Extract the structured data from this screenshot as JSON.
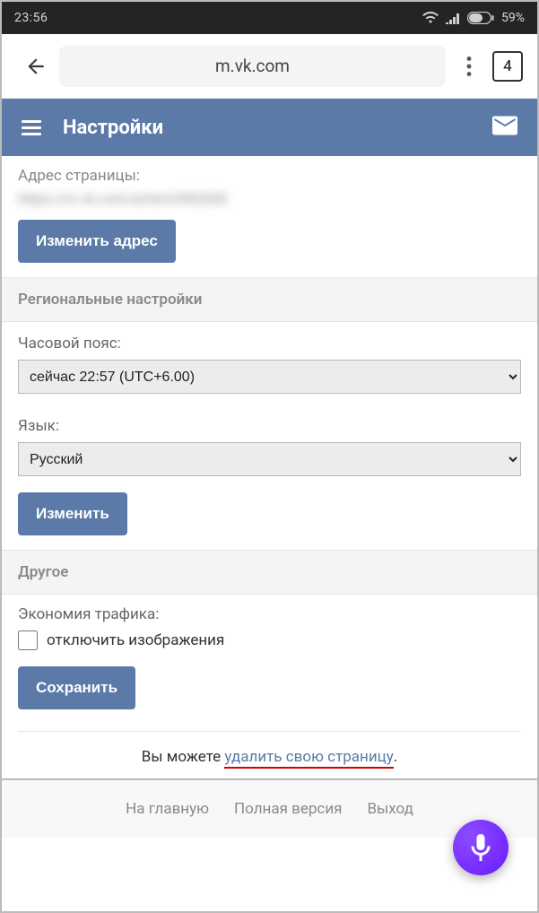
{
  "statusBar": {
    "time": "23:56",
    "battery": "59%"
  },
  "browser": {
    "url": "m.vk.com",
    "tabs": "4"
  },
  "header": {
    "title": "Настройки"
  },
  "addressSection": {
    "label": "Адрес страницы:",
    "blurred": "https://m.vk.com/artem2982000",
    "button": "Изменить адрес"
  },
  "regional": {
    "header": "Региональные настройки",
    "tz_label": "Часовой пояс:",
    "tz_value": "сейчас 22:57 (UTC+6.00)",
    "lang_label": "Язык:",
    "lang_value": "Русский",
    "button": "Изменить"
  },
  "other": {
    "header": "Другое",
    "traffic_label": "Экономия трафика:",
    "checkbox_label": "отключить изображения",
    "save_button": "Сохранить"
  },
  "deleteRow": {
    "prefix": "Вы можете ",
    "link": "удалить свою страницу",
    "suffix": "."
  },
  "footer": {
    "home": "На главную",
    "full": "Полная версия",
    "exit": "Выход"
  }
}
